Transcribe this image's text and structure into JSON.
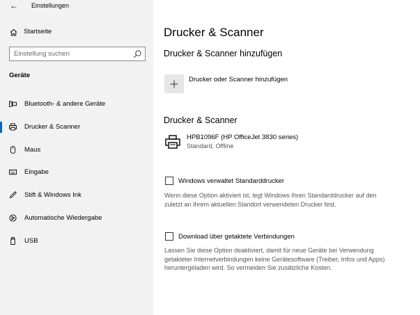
{
  "window": {
    "title": "Einstellungen"
  },
  "sidebar": {
    "home_label": "Startseite",
    "search_placeholder": "Einstellung suchen",
    "section_label": "Geräte",
    "items": [
      {
        "label": "Bluetooth- & andere Geräte",
        "icon": "bluetooth-devices-icon",
        "active": false
      },
      {
        "label": "Drucker & Scanner",
        "icon": "printer-icon",
        "active": true
      },
      {
        "label": "Maus",
        "icon": "mouse-icon",
        "active": false
      },
      {
        "label": "Eingabe",
        "icon": "keyboard-icon",
        "active": false
      },
      {
        "label": "Stift & Windows Ink",
        "icon": "pen-icon",
        "active": false
      },
      {
        "label": "Automatische Wiedergabe",
        "icon": "autoplay-icon",
        "active": false
      },
      {
        "label": "USB",
        "icon": "usb-icon",
        "active": false
      }
    ]
  },
  "main": {
    "title": "Drucker & Scanner",
    "add_section_title": "Drucker & Scanner hinzufügen",
    "add_button_label": "Drucker oder Scanner hinzufügen",
    "list_section_title": "Drucker & Scanner",
    "printers": [
      {
        "name": "HPB1096F (HP OfficeJet 3830 series)",
        "status": "Standard, Offline"
      }
    ],
    "options": [
      {
        "label": "Windows verwaltet Standarddrucker",
        "checked": false,
        "description": "Wenn diese Option aktiviert ist, legt Windows Ihren Standarddrucker auf den zuletzt an Ihrem aktuellen Standort verwendeten Drucker fest."
      },
      {
        "label": "Download über getaktete Verbindungen",
        "checked": false,
        "description": "Lassen Sie diese Option deaktiviert, damit für neue Geräte bei Verwendung getakteter Internetverbindungen keine Gerätesoftware (Treiber, Infos und Apps) heruntergeladen wird. So vermeiden Sie zusätzliche Kosten."
      }
    ]
  },
  "colors": {
    "accent": "#0067c0",
    "sidebar_bg": "#f2f2f2",
    "add_button_bg": "#e6e6e6"
  }
}
